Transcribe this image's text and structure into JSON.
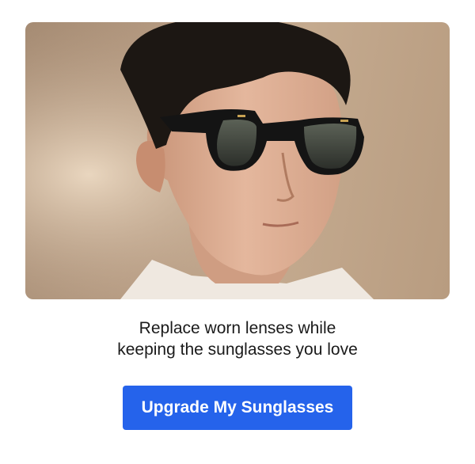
{
  "hero": {
    "image": "man-wearing-black-sunglasses-photo",
    "background_color": "#b69b82"
  },
  "tagline": {
    "line1": "Replace worn lenses while",
    "line2": "keeping the sunglasses you love"
  },
  "cta": {
    "label": "Upgrade My Sunglasses",
    "color": "#2563eb"
  }
}
